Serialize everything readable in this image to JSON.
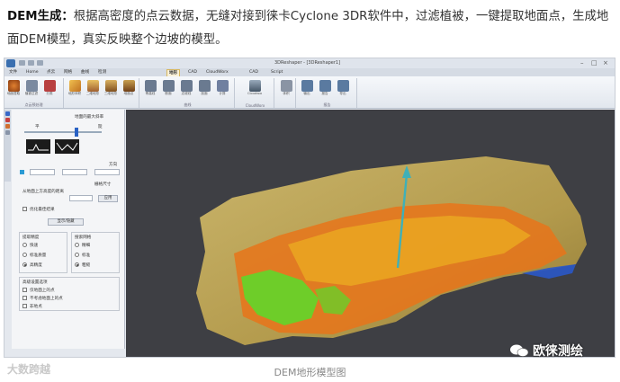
{
  "intro": {
    "label": "DEM生成：",
    "text": "根据高密度的点云数据，无缝对接到徕卡Cyclone 3DR软件中，过滤植被，一键提取地面点，生成地面DEM模型，真实反映整个边坡的模型。"
  },
  "app": {
    "window_title": "3DReshaper - [3DReshaper1]",
    "tabs": [
      "文件",
      "Home",
      "点云",
      "网格",
      "曲线",
      "检测",
      "CAD",
      "CloudWorx",
      "地形",
      "CAD",
      "Script"
    ],
    "active_tab": "地形",
    "ribbon_groups": [
      {
        "label": "点云预处理",
        "buttons": [
          "地面提取",
          "植被过滤",
          "分类"
        ]
      },
      {
        "label": "",
        "buttons": [
          "地形体积",
          "二维地形",
          "三维地形",
          "地面点"
        ]
      },
      {
        "label": "曲线",
        "buttons": [
          "等高线",
          "断面",
          "边坡线",
          "剖面",
          "计算"
        ]
      },
      {
        "label": "CloudWorx",
        "buttons": [
          "Cloudworx"
        ]
      },
      {
        "label": "",
        "buttons": [
          "体积"
        ]
      },
      {
        "label": "报告",
        "buttons": [
          "输出",
          "报告",
          "导出"
        ]
      }
    ],
    "left_panel": {
      "slider_label": "地面的最大斜率",
      "slider_min": "平",
      "slider_max": "陡",
      "direction_label": "方向",
      "grid_label": "栅格尺寸",
      "height_label": "从地面上方高度的距离",
      "apply_button": "应用",
      "refresh_option": "优化最佳结果",
      "compute_button": "显示/隐藏",
      "group1_title": "提取精度",
      "group1_options": [
        "快速",
        "标准质量",
        "高精度"
      ],
      "group1_selected": 2,
      "group2_title": "搜索网格",
      "group2_options": [
        "精细",
        "标准",
        "粗糙"
      ],
      "group2_selected": 2,
      "section3_title": "高级设置选项",
      "checks": [
        "仅地面上的点",
        "不考虑地面上的点",
        "非地点"
      ]
    }
  },
  "caption": "DEM地形模型图",
  "watermark_left": "大数跨越",
  "watermark_right": "欧徕测绘",
  "colors": {
    "terrain": "#b8a054",
    "cloud_orange": "#e8741a",
    "cloud_green": "#62d62a",
    "normal_arrow": "#3fb0b8",
    "viewport_bg": "#3e3f44"
  }
}
